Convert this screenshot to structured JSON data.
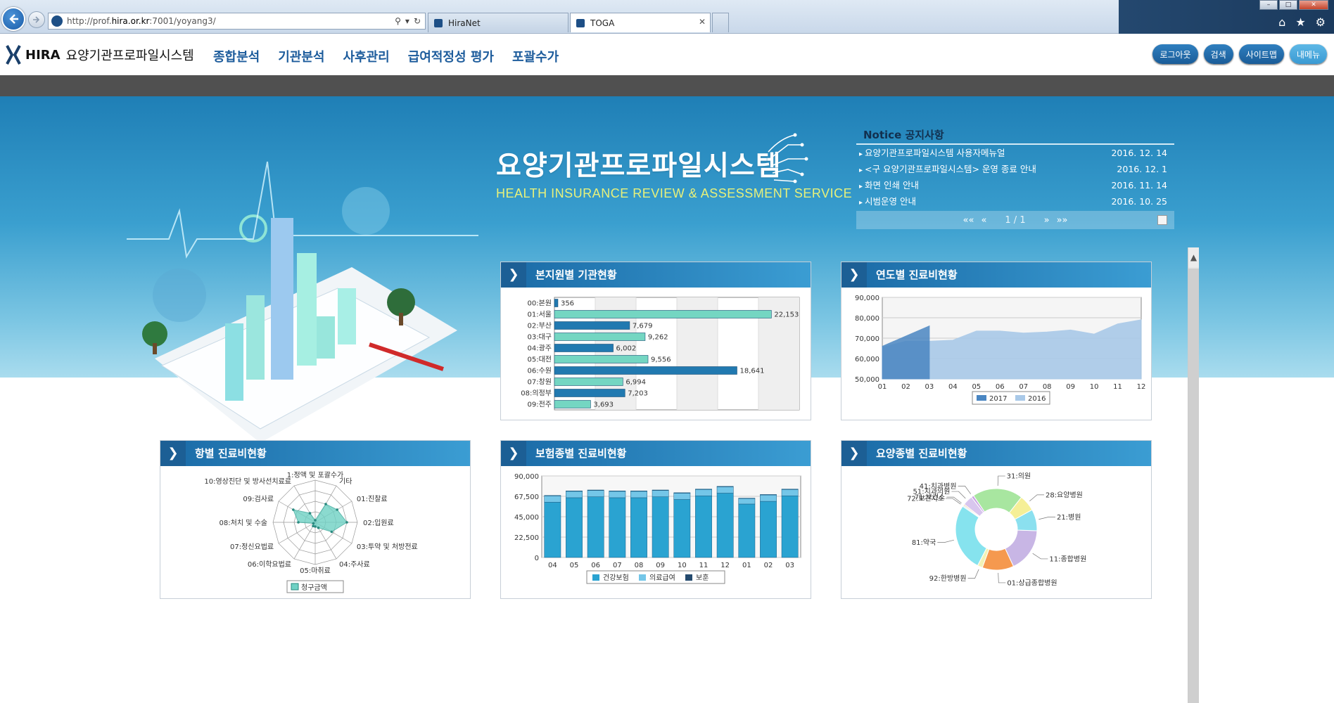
{
  "browser": {
    "url_prefix": "http://prof.",
    "url_host": "hira.or.kr",
    "url_rest": ":7001/yoyang3/",
    "tabs": [
      {
        "label": "HiraNet"
      },
      {
        "label": "TOGA"
      }
    ]
  },
  "header": {
    "logo_text": "HIRA",
    "system_name": "요양기관프로파일시스템",
    "nav": [
      "종합분석",
      "기관분석",
      "사후관리",
      "급여적정성 평가",
      "포괄수가"
    ],
    "util_buttons": [
      "로그아웃",
      "검색",
      "사이트맵",
      "내메뉴"
    ]
  },
  "hero": {
    "title": "요양기관프로파일시스템",
    "subtitle": "HEALTH INSURANCE REVIEW & ASSESSMENT SERVICE"
  },
  "notice": {
    "title": "Notice 공지사항",
    "items": [
      {
        "title": "요양기관프로파일시스템 사용자메뉴얼",
        "date": "2016. 12. 14"
      },
      {
        "title": "<구 요양기관프로파일시스템> 운영 종료 안내",
        "date": "2016. 12. 1"
      },
      {
        "title": "화면 인쇄 안내",
        "date": "2016. 11. 14"
      },
      {
        "title": "시범운영 안내",
        "date": "2016. 10. 25"
      }
    ],
    "pager": {
      "first": "««",
      "prev": "«",
      "page": "1 / 1",
      "next": "»",
      "last": "»»"
    }
  },
  "panels": {
    "branch": "본지원별 기관현황",
    "year": "연도별 진료비현황",
    "item": "항별 진료비현황",
    "insurance": "보험종별 진료비현황",
    "inst_type": "요양종별 진료비현황"
  },
  "chart_data": [
    {
      "id": "branch",
      "type": "bar",
      "orientation": "horizontal",
      "categories": [
        "00:본원",
        "01:서울",
        "02:부산",
        "03:대구",
        "04:광주",
        "05:대전",
        "06:수원",
        "07:창원",
        "08:의정부",
        "09:전주"
      ],
      "values": [
        356,
        22153,
        7679,
        9262,
        6002,
        9556,
        18641,
        6994,
        7203,
        3693
      ],
      "value_labels": [
        "356",
        "22,153",
        "7,679",
        "9,262",
        "6,002",
        "9,556",
        "18,641",
        "6,994",
        "7,203",
        "3,693"
      ],
      "xlim": [
        0,
        25000
      ],
      "colors": {
        "even": "#2179b0",
        "odd": "#74d6c2"
      }
    },
    {
      "id": "year",
      "type": "area",
      "x": [
        "01",
        "02",
        "03",
        "04",
        "05",
        "06",
        "07",
        "08",
        "09",
        "10",
        "11",
        "12"
      ],
      "yticks": [
        "90,000",
        "80,000",
        "70,000",
        "60,000",
        "50,000"
      ],
      "ylim": [
        50000,
        90000
      ],
      "series": [
        {
          "name": "2017",
          "values": [
            66000,
            71000,
            76000
          ],
          "color": "#4a86c2"
        },
        {
          "name": "2016",
          "values": [
            65500,
            68500,
            68500,
            69000,
            73500,
            73500,
            72500,
            73000,
            74000,
            72000,
            77000,
            79000
          ],
          "color": "#a9c9e8"
        }
      ]
    },
    {
      "id": "item",
      "type": "radar",
      "categories": [
        "1:정액 및 포괄수가",
        "기타",
        "01:진찰료",
        "02:입원료",
        "03:투약 및 처방전료",
        "04:주사료",
        "05:마취료",
        "06:이학요법료",
        "07:정신요법료",
        "08:처치 및 수술",
        "09:검사료",
        "10:영상진단 및 방사선치료료"
      ],
      "series": [
        {
          "name": "청구금액",
          "values": [
            0.05,
            0.5,
            0.6,
            0.75,
            0.45,
            0.15,
            0.1,
            0.1,
            0.05,
            0.4,
            0.6,
            0.25
          ],
          "color": "#6fd1c4"
        }
      ]
    },
    {
      "id": "insurance",
      "type": "bar",
      "stacked": true,
      "categories": [
        "04",
        "05",
        "06",
        "07",
        "08",
        "09",
        "10",
        "11",
        "12",
        "01",
        "02",
        "03"
      ],
      "yticks": [
        "90,000",
        "67,500",
        "45,000",
        "22,500",
        "0"
      ],
      "ylim": [
        0,
        90000
      ],
      "series": [
        {
          "name": "건강보험",
          "values": [
            61000,
            66000,
            67000,
            66000,
            66000,
            67000,
            64000,
            68000,
            71000,
            59000,
            62000,
            68000
          ],
          "color": "#2aa3d1"
        },
        {
          "name": "의료급여",
          "values": [
            7000,
            7000,
            7000,
            7000,
            7000,
            7000,
            7000,
            7000,
            7000,
            6000,
            7000,
            7000
          ],
          "color": "#74c6e8"
        },
        {
          "name": "보훈",
          "values": [
            500,
            500,
            500,
            500,
            500,
            500,
            500,
            500,
            500,
            500,
            500,
            500
          ],
          "color": "#244a6e"
        }
      ]
    },
    {
      "id": "inst_type",
      "type": "pie",
      "donut": true,
      "labels": [
        "01:상급종합병원",
        "11:종합병원",
        "21:병원",
        "28:요양병원",
        "31:의원",
        "41:치과병원",
        "51:치과의원",
        "71:보건소",
        "72:보건지소",
        "81:약국",
        "92:한방병원"
      ],
      "values": [
        12.5,
        17.5,
        8.5,
        6.5,
        20,
        1,
        4,
        0.5,
        0.5,
        27,
        2
      ],
      "colors": [
        "#f5994f",
        "#c8b6e5",
        "#8be0ef",
        "#f5ef97",
        "#a8e6a0",
        "#c9a3e2",
        "#d8c6ee",
        "#f7c99b",
        "#c7e5f3",
        "#86e3ee",
        "#f2f2b6"
      ]
    }
  ]
}
